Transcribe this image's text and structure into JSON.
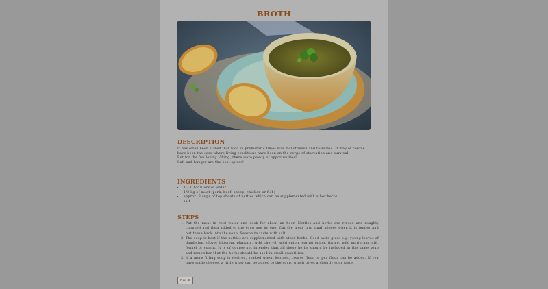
{
  "title": "BROTH",
  "hero_image": {
    "alt": "soup-bowl-with-bread",
    "icon": "food-photo"
  },
  "description": {
    "heading": "DESCRIPTION",
    "paragraphs": [
      "It has often been stated that food in prehistoric times was monotonous and tasteless. It may of course have been the case where living conditions have been on the verge of starvation and survival.",
      "But for the fun-loving Viking, there were plenty of opportunities!",
      "Salt and hunger are the best spices!"
    ]
  },
  "ingredients": {
    "heading": "INGREDIENTS",
    "items": [
      "1 - 1 1/2 liters of water",
      "1/2 kg of meat (pork, beef, sheep, chicken or fish)",
      "approx. 3 cups of top shoots of nettles which can be supplemented with other herbs",
      "salt"
    ]
  },
  "steps": {
    "heading": "STEPS",
    "items": [
      "Put the meat in cold water and cook for about an hour. Nettles and herbs are rinsed and roughly chopped and then added to the soup one by one. Cut the meat into small pieces when it is tender and put these back into the soup. Season to taste with salt.",
      "The soup is best if the nettles are supplemented with other herbs. Good taste gives e.g. young leaves of dandelion, clover blossom, plantain, wild chervil, wild onion, spring onion, thyme, wild marjoram, dill, fennel or cumin. It is of course not intended that all these herbs should be included in the same soup and remember that the herbs should be used in small quantities.",
      "If a more filling soup is desired, soaked wheat kernels, coarse flour or pea flour can be added. If you have made cheese, a little whey can be added to the soup, which gives a slightly sour taste."
    ]
  },
  "back_button": {
    "label": "BACK"
  },
  "colors": {
    "background": "#999999",
    "panel": "#b2b2b2",
    "accent": "#8a4a1a"
  }
}
